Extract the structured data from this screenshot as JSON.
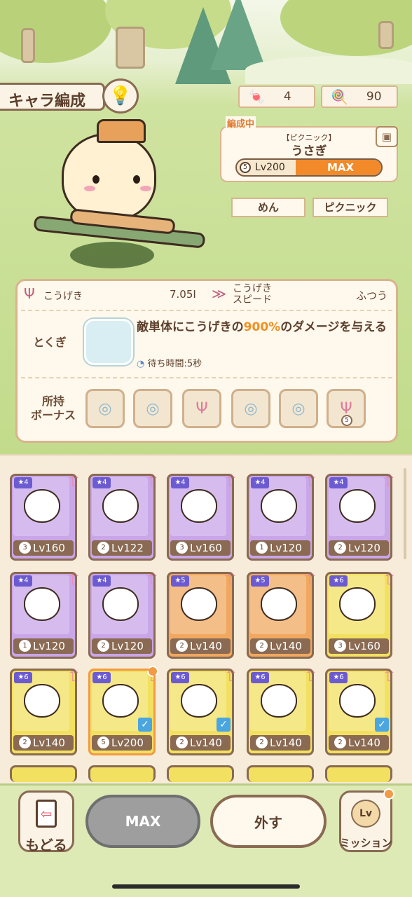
{
  "header": {
    "title": "キャラ編成",
    "currency": [
      {
        "icon": "candy-icon",
        "value": "4"
      },
      {
        "icon": "lollipop-icon",
        "value": "90"
      }
    ]
  },
  "formation": {
    "label": "編成中",
    "character_subtitle": "【ピクニック】",
    "character_name": "うさぎ",
    "rank": "5",
    "level": "Lv200",
    "level_status": "MAX",
    "level_fill": 1.0,
    "tags": [
      "めん",
      "ピクニック"
    ]
  },
  "stats": {
    "attack_label": "こうげき",
    "attack_value": "7.05I",
    "speed_label_line1": "こうげき",
    "speed_label_line2": "スピード",
    "speed_value": "ふつう",
    "special_label": "とくぎ",
    "special_text_pre": "敵単体にこうげきの",
    "special_text_hl": "900%",
    "special_text_post": "のダメージを与える",
    "wait_text": "待ち時間:5秒",
    "bonus_label_line1": "所持",
    "bonus_label_line2": "ボーナス",
    "bonus_badge": "5"
  },
  "characters": [
    {
      "stars": "4",
      "rank": "3",
      "level": "Lv160",
      "color": "#c9a6e8"
    },
    {
      "stars": "4",
      "rank": "2",
      "level": "Lv122",
      "color": "#c9a6e8"
    },
    {
      "stars": "4",
      "rank": "3",
      "level": "Lv160",
      "color": "#c9a6e8"
    },
    {
      "stars": "4",
      "rank": "1",
      "level": "Lv120",
      "color": "#c9a6e8"
    },
    {
      "stars": "4",
      "rank": "2",
      "level": "Lv120",
      "color": "#c9a6e8"
    },
    {
      "stars": "4",
      "rank": "1",
      "level": "Lv120",
      "color": "#c9a6e8"
    },
    {
      "stars": "4",
      "rank": "2",
      "level": "Lv120",
      "color": "#c9a6e8"
    },
    {
      "stars": "5",
      "rank": "2",
      "level": "Lv140",
      "color": "#f0a860"
    },
    {
      "stars": "5",
      "rank": "2",
      "level": "Lv140",
      "color": "#f0a860"
    },
    {
      "stars": "6",
      "rank": "3",
      "level": "Lv160",
      "color": "#f2e060"
    },
    {
      "stars": "6",
      "rank": "2",
      "level": "Lv140",
      "color": "#f2e060"
    },
    {
      "stars": "6",
      "rank": "5",
      "level": "Lv200",
      "color": "#f2e060"
    },
    {
      "stars": "6",
      "rank": "2",
      "level": "Lv140",
      "color": "#f2e060"
    },
    {
      "stars": "6",
      "rank": "2",
      "level": "Lv140",
      "color": "#f2e060"
    },
    {
      "stars": "6",
      "rank": "2",
      "level": "Lv140",
      "color": "#f2e060"
    }
  ],
  "bottom": {
    "back_label": "もどる",
    "max_label": "MAX",
    "unequip_label": "外す",
    "mission_label": "ミッション",
    "mission_badge": "Lv"
  }
}
